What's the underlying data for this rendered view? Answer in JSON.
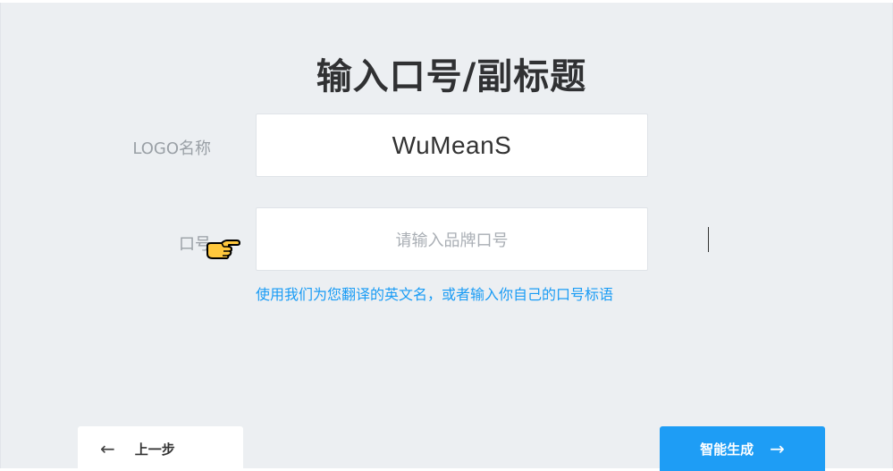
{
  "page": {
    "title": "输入口号/副标题"
  },
  "form": {
    "logo_label": "LOGO名称",
    "logo_value": "WuMeanS",
    "slogan_label": "口号",
    "slogan_placeholder": "请输入品牌口号",
    "slogan_hint": "使用我们为您翻译的英文名，或者输入你自己的口号标语"
  },
  "buttons": {
    "prev_arrow": "←",
    "prev_label": "上一步",
    "next_label": "智能生成",
    "next_arrow": "→"
  },
  "icons": {
    "pointer": "pointing-hand-icon"
  },
  "colors": {
    "background": "#eceff2",
    "accent": "#1e9df5",
    "hint_text": "#1a9cf5",
    "title_text": "#303133"
  }
}
